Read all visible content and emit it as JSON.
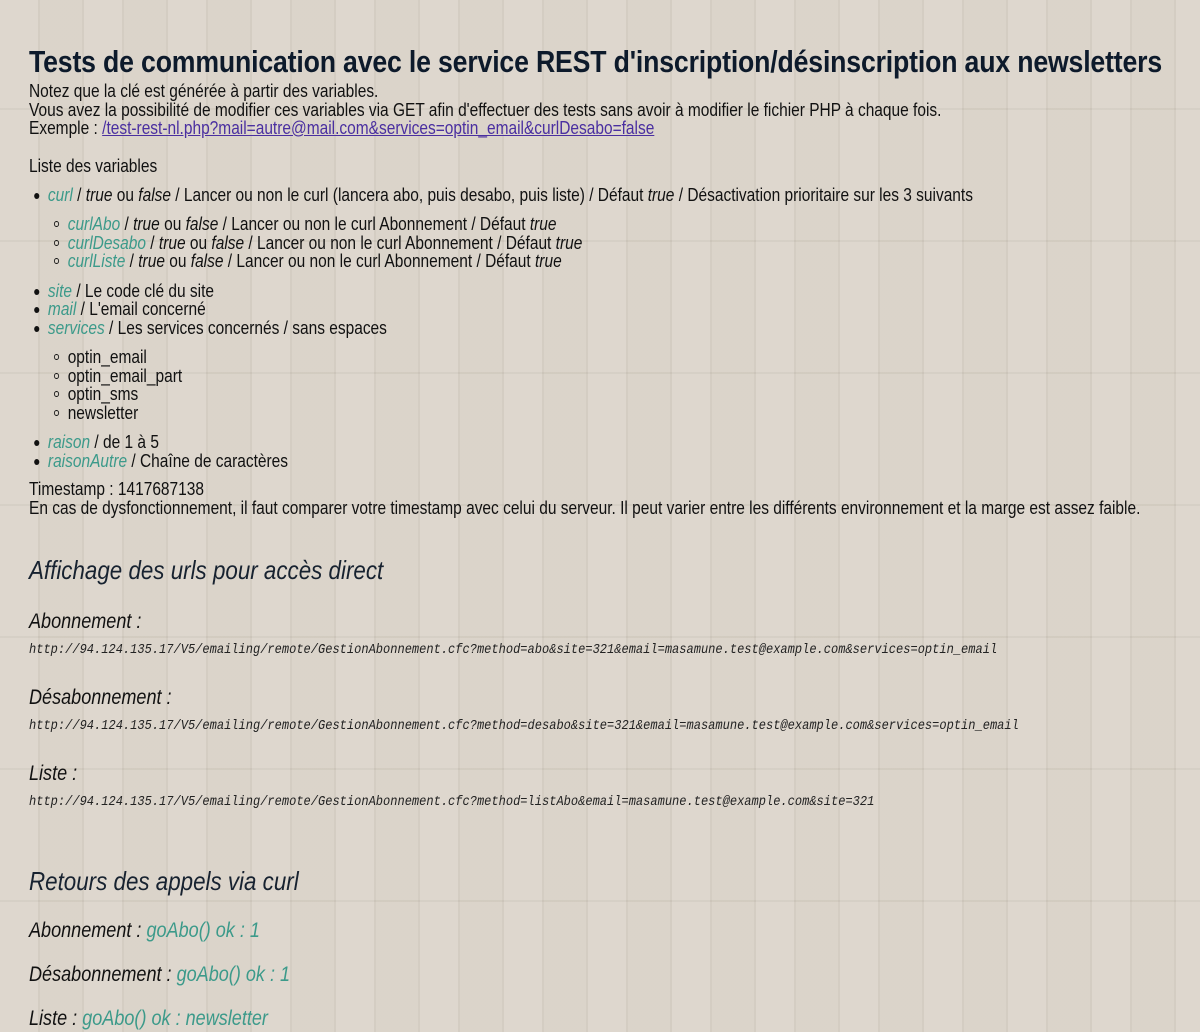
{
  "title": "Tests de communication avec le service REST d'inscription/désinscription aux newsletters",
  "intro": {
    "line1": "Notez que la clé est générée à partir des variables.",
    "line2": "Vous avez la possibilité de modifier ces variables via GET afin d'effectuer des tests sans avoir à modifier le fichier PHP à chaque fois.",
    "example_label": "Exemple : ",
    "example_link": "/test-rest-nl.php?mail=autre@mail.com&services=optin_email&curlDesabo=false"
  },
  "variables_title": "Liste des variables",
  "variables": {
    "curl": {
      "name": "curl",
      "t1": " / ",
      "v1": "true",
      "t2": " ou ",
      "v2": "false",
      "desc": " / Lancer ou non le curl (lancera abo, puis desabo, puis liste) / Défaut ",
      "def": "true",
      "tail": " / Désactivation prioritaire sur les 3 suivants"
    },
    "curl_sub": [
      {
        "name": "curlAbo",
        "t1": " / ",
        "v1": "true",
        "t2": " ou ",
        "v2": "false",
        "desc": " / Lancer ou non le curl Abonnement / Défaut ",
        "def": "true"
      },
      {
        "name": "curlDesabo",
        "t1": " / ",
        "v1": "true",
        "t2": " ou ",
        "v2": "false",
        "desc": " / Lancer ou non le curl Abonnement / Défaut ",
        "def": "true"
      },
      {
        "name": "curlListe",
        "t1": " / ",
        "v1": "true",
        "t2": " ou ",
        "v2": "false",
        "desc": " / Lancer ou non le curl Abonnement / Défaut ",
        "def": "true"
      }
    ],
    "site": {
      "name": "site",
      "desc": " / Le code clé du site"
    },
    "mail": {
      "name": "mail",
      "desc": " / L'email concerné"
    },
    "services": {
      "name": "services",
      "desc": " / Les services concernés / sans espaces"
    },
    "services_list": [
      "optin_email",
      "optin_email_part",
      "optin_sms",
      "newsletter"
    ],
    "raison": {
      "name": "raison",
      "desc": " / de 1 à 5"
    },
    "raisonAutre": {
      "name": "raisonAutre",
      "desc": " / Chaîne de caractères"
    }
  },
  "timestamp": {
    "line": "Timestamp : 1417687138",
    "note": "En cas de dysfonctionnement, il faut comparer votre timestamp avec celui du serveur. Il peut varier entre les différents environnement et la marge est assez faible."
  },
  "urls_section": {
    "heading": "Affichage des urls pour accès direct",
    "abo_label": "Abonnement :",
    "abo_url": "http://94.124.135.17/V5/emailing/remote/GestionAbonnement.cfc?method=abo&site=321&email=masamune.test@example.com&services=optin_email",
    "desabo_label": "Désabonnement :",
    "desabo_url": "http://94.124.135.17/V5/emailing/remote/GestionAbonnement.cfc?method=desabo&site=321&email=masamune.test@example.com&services=optin_email",
    "liste_label": "Liste :",
    "liste_url": "http://94.124.135.17/V5/emailing/remote/GestionAbonnement.cfc?method=listAbo&email=masamune.test@example.com&site=321"
  },
  "curl_section": {
    "heading": "Retours des appels via curl",
    "abo_label": "Abonnement : ",
    "abo_value": "goAbo() ok : 1",
    "desabo_label": "Désabonnement : ",
    "desabo_value": "goAbo() ok : 1",
    "liste_label": "Liste : ",
    "liste_value": "goAbo() ok : newsletter"
  }
}
